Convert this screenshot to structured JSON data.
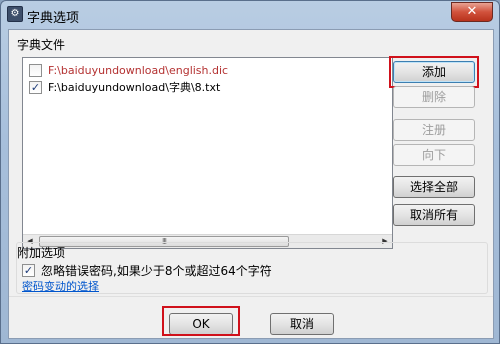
{
  "window": {
    "title": "字典选项",
    "close_label": "✕",
    "icon_label": "⚙"
  },
  "dictionary_group": {
    "label": "字典文件"
  },
  "dictionary_list": [
    {
      "checked": false,
      "path": "F:\\baiduyundownload\\english.dic",
      "color": "#b43232"
    },
    {
      "checked": true,
      "path": "F:\\baiduyundownload\\字典\\8.txt",
      "color": "#000000"
    }
  ],
  "scrollbar": {
    "left_arrow": "◀",
    "right_arrow": "▶",
    "thumb_grip": "III"
  },
  "side_buttons": {
    "add": "添加",
    "delete": "删除",
    "register": "注册",
    "move_down": "向下",
    "select_all": "选择全部",
    "deselect_all": "取消所有"
  },
  "extra_options": {
    "label": "附加选项",
    "ignore_password": {
      "checked": true,
      "label": "忽略错误密码,如果少于8个或超过64个字符"
    },
    "password_change_link": "密码变动的选择"
  },
  "footer": {
    "ok": "OK",
    "cancel": "取消"
  },
  "colors": {
    "highlight": "#d0111b",
    "link": "#0055cc",
    "title_bar": "#a7bfdb"
  }
}
